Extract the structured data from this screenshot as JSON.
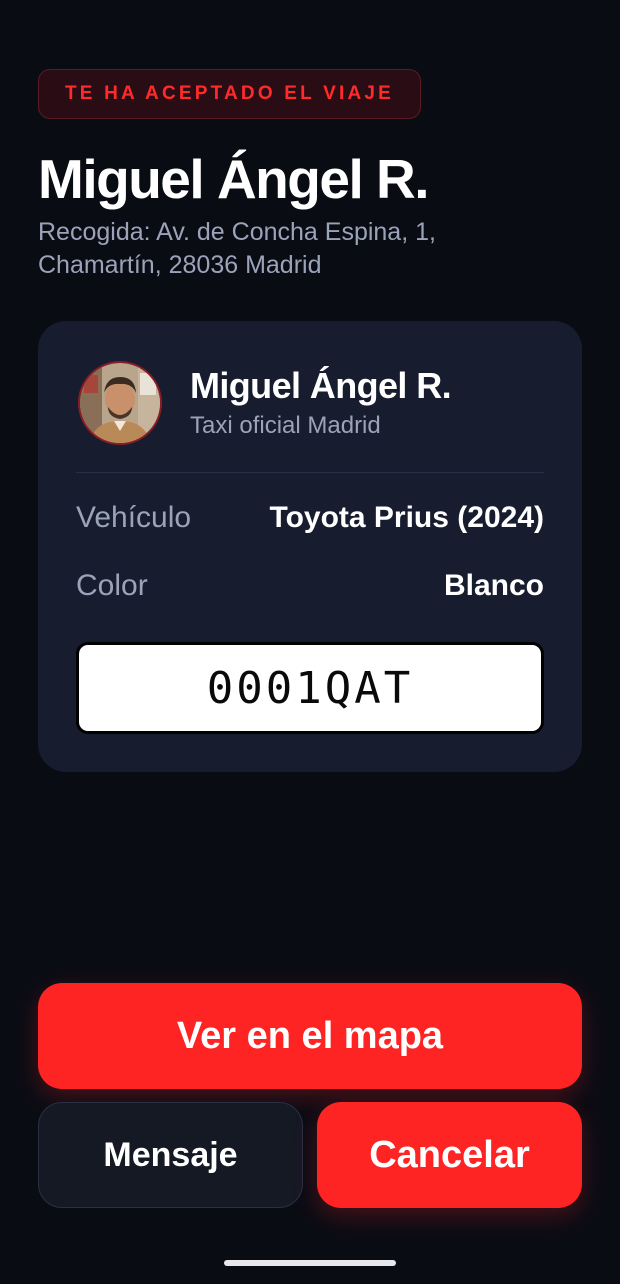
{
  "status_badge": "TE HA ACEPTADO EL VIAJE",
  "title": "Miguel Ángel R.",
  "pickup": {
    "line1": "Recogida: Av. de Concha Espina, 1,",
    "line2": "Chamartín, 28036 Madrid"
  },
  "driver": {
    "name": "Miguel Ángel R.",
    "subtitle": "Taxi oficial Madrid",
    "avatar_icon": "driver-avatar-photo"
  },
  "details": {
    "vehicle_label": "Vehículo",
    "vehicle_value": "Toyota Prius (2024)",
    "color_label": "Color",
    "color_value": "Blanco",
    "plate": "0001QAT"
  },
  "actions": {
    "map_label": "Ver en el mapa",
    "message_label": "Mensaje",
    "cancel_label": "Cancelar"
  },
  "colors": {
    "background": "#0a0c14",
    "card": "#171c2f",
    "accent": "#ff2424",
    "muted_text": "#9ba3ba"
  }
}
